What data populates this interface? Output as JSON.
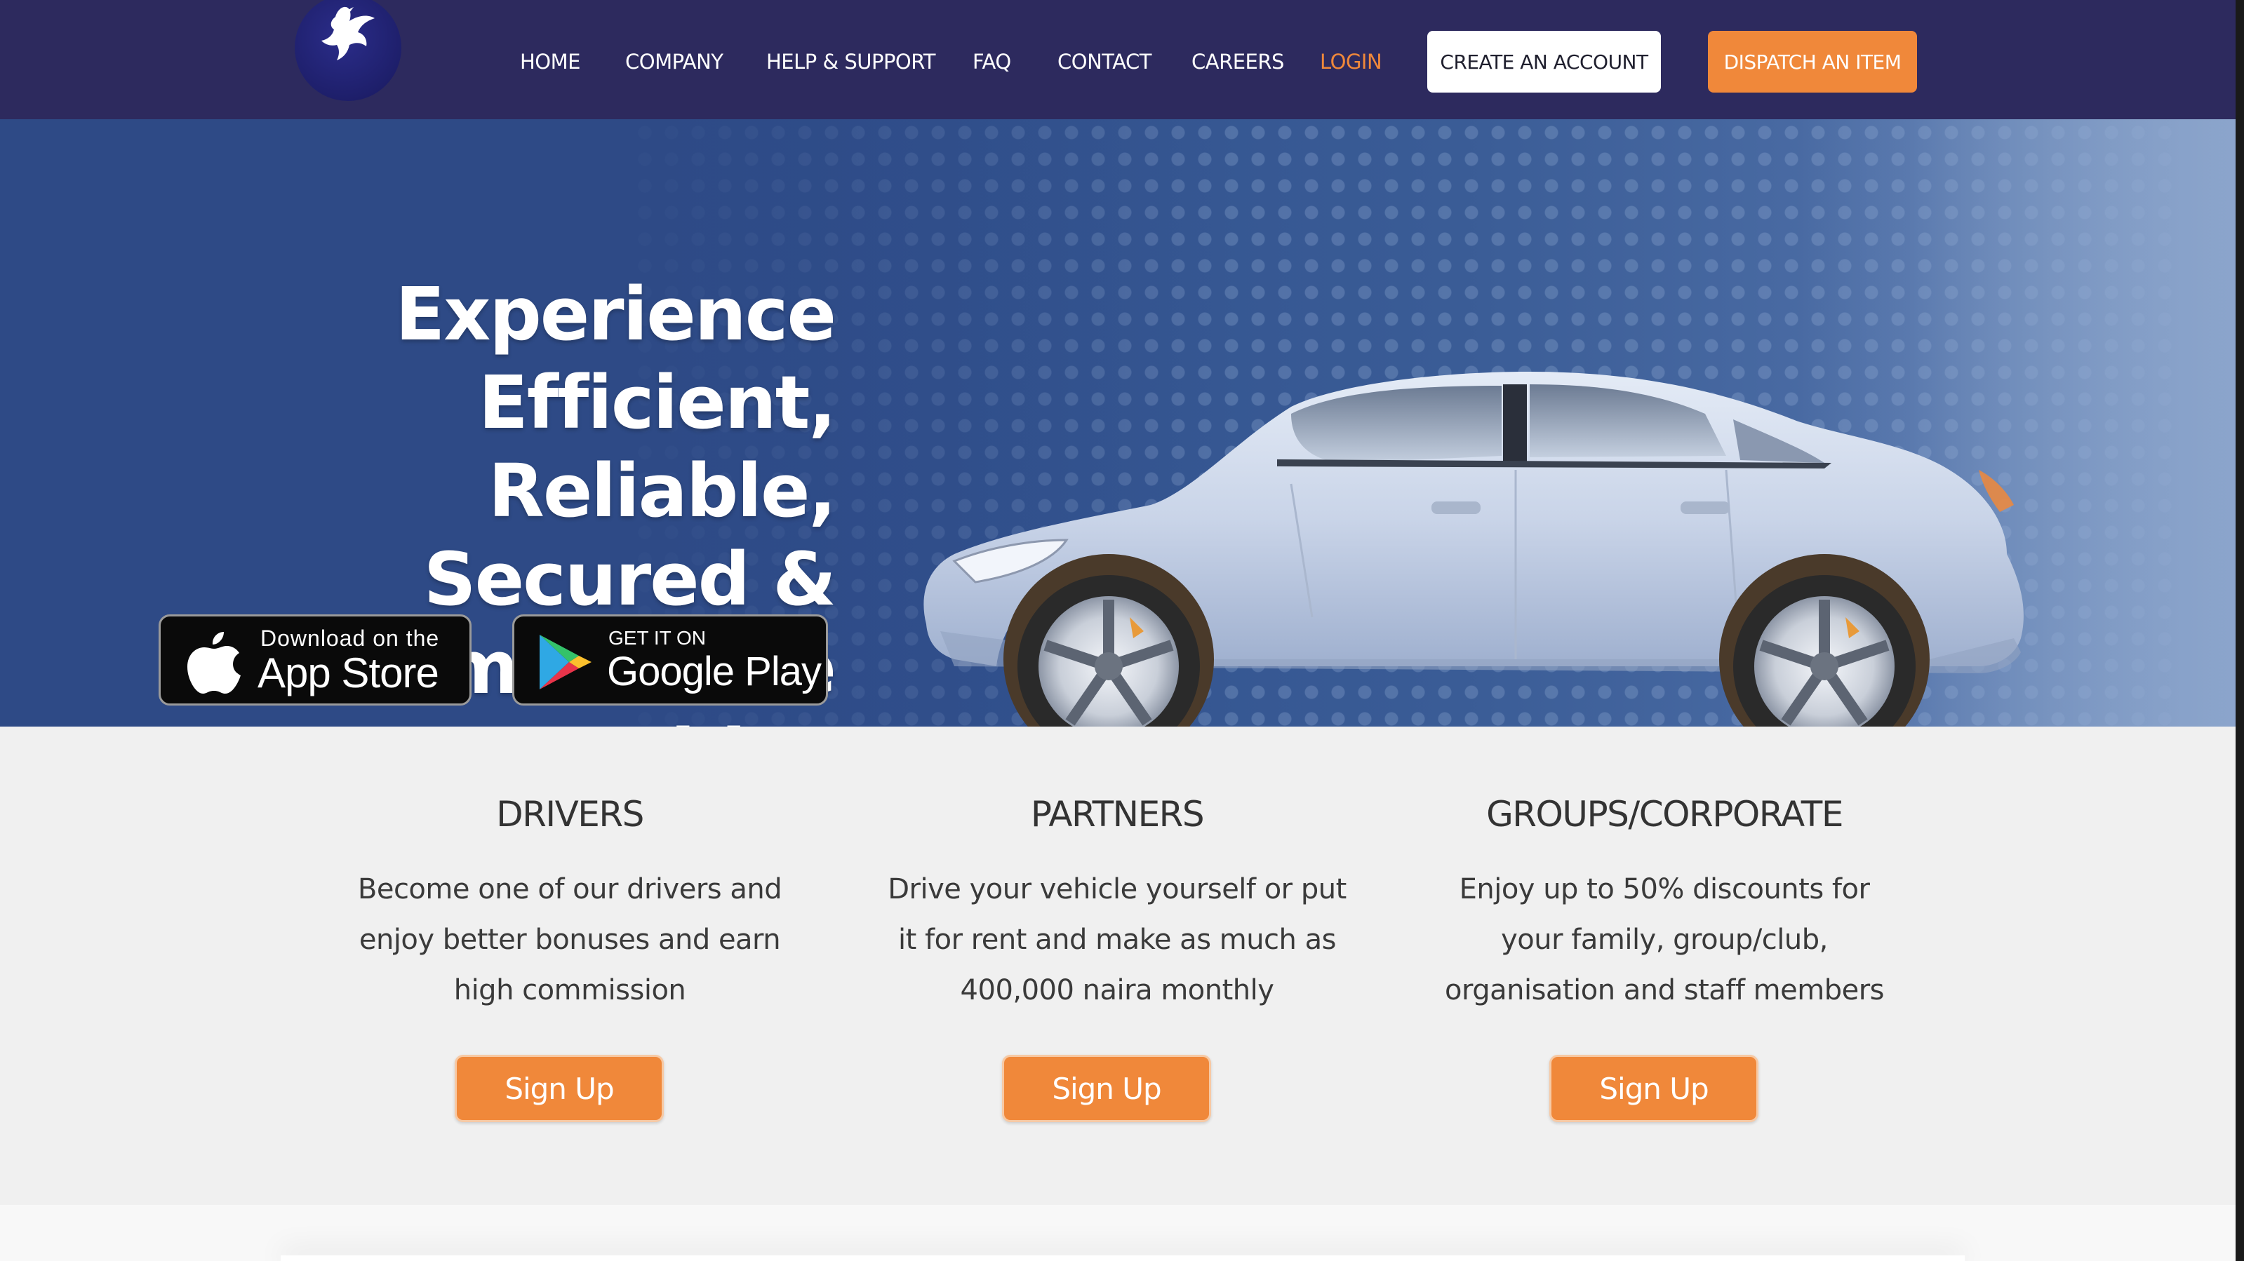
{
  "nav": {
    "logo_icon": "dove-icon",
    "links": [
      "HOME",
      "COMPANY",
      "HELP & SUPPORT",
      "FAQ",
      "CONTACT",
      "CAREERS",
      "LOGIN"
    ],
    "create_account": "CREATE AN ACCOUNT",
    "dispatch": "DISPATCH AN ITEM",
    "colors": {
      "nav_bg": "#2d2a5e",
      "accent": "#f0883a"
    }
  },
  "hero": {
    "title_lines": [
      "Experience Efficient,",
      "Reliable, Secured &",
      "Comfortable Rides"
    ],
    "app_store": {
      "small": "Download on the",
      "big": "App Store",
      "icon": "apple-icon"
    },
    "google_play": {
      "small": "GET IT ON",
      "big": "Google Play",
      "icon": "play-store-icon"
    },
    "image": "sedan-car"
  },
  "services": [
    {
      "title": "DRIVERS",
      "description_lines": [
        "Become one of our drivers and",
        "enjoy better bonuses and earn",
        "high commission"
      ],
      "button": "Sign Up"
    },
    {
      "title": "PARTNERS",
      "description_lines": [
        "Drive your vehicle yourself or put",
        "it for rent and make as much as",
        "400,000 naira monthly"
      ],
      "button": "Sign Up"
    },
    {
      "title": "GROUPS/CORPORATE",
      "description_lines": [
        "Enjoy up to 50% discounts for",
        "your family, group/club,",
        "organisation and staff members"
      ],
      "button": "Sign Up"
    }
  ]
}
